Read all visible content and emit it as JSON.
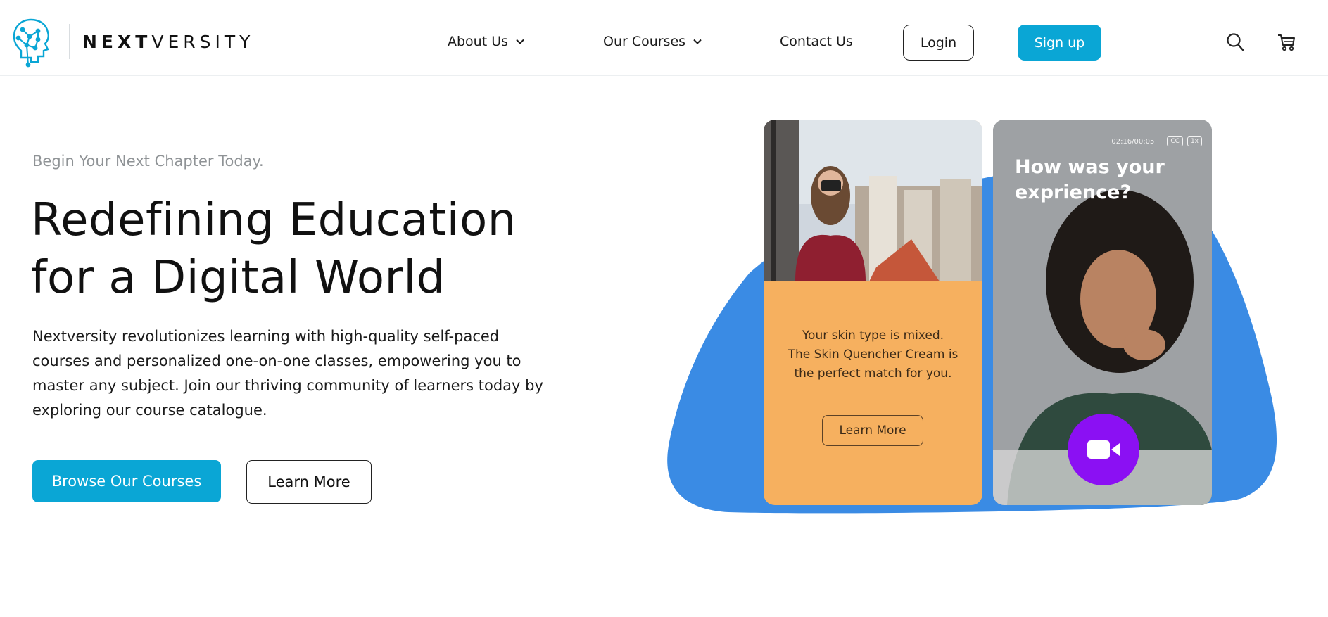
{
  "brand": {
    "name_bold": "NEXT",
    "name_light": "VERSITY",
    "logo_icon": "brain-network-icon",
    "accent_color": "#0aa6d5"
  },
  "nav": {
    "items": [
      {
        "label": "About Us",
        "has_dropdown": true
      },
      {
        "label": "Our Courses",
        "has_dropdown": true
      },
      {
        "label": "Contact Us",
        "has_dropdown": false
      }
    ],
    "login_label": "Login",
    "signup_label": "Sign up",
    "search_icon": "search-icon",
    "cart_icon": "cart-icon"
  },
  "hero": {
    "eyebrow": "Begin Your Next Chapter Today.",
    "headline_line1": "Redefining Education",
    "headline_line2": "for a Digital World",
    "body": "Nextversity revolutionizes learning with high-quality self-paced courses and personalized one-on-one classes, empowering you to master any subject. Join our thriving community of learners today by exploring our course catalogue.",
    "primary_cta": "Browse Our Courses",
    "secondary_cta": "Learn More"
  },
  "illustration": {
    "blob_color": "#3a8be4",
    "left_card": {
      "bg_color": "#f6b05f",
      "text_line1": "Your skin type is mixed.",
      "text_line2": "The Skin Quencher Cream is",
      "text_line3": "the perfect match for you.",
      "button_label": "Learn More"
    },
    "right_card": {
      "time": "02:16/00:05",
      "cc_label": "CC",
      "speed_label": "1x",
      "question": "How was your exprience?",
      "record_button_color": "#8b10f3",
      "record_icon": "video-camera-icon"
    }
  }
}
